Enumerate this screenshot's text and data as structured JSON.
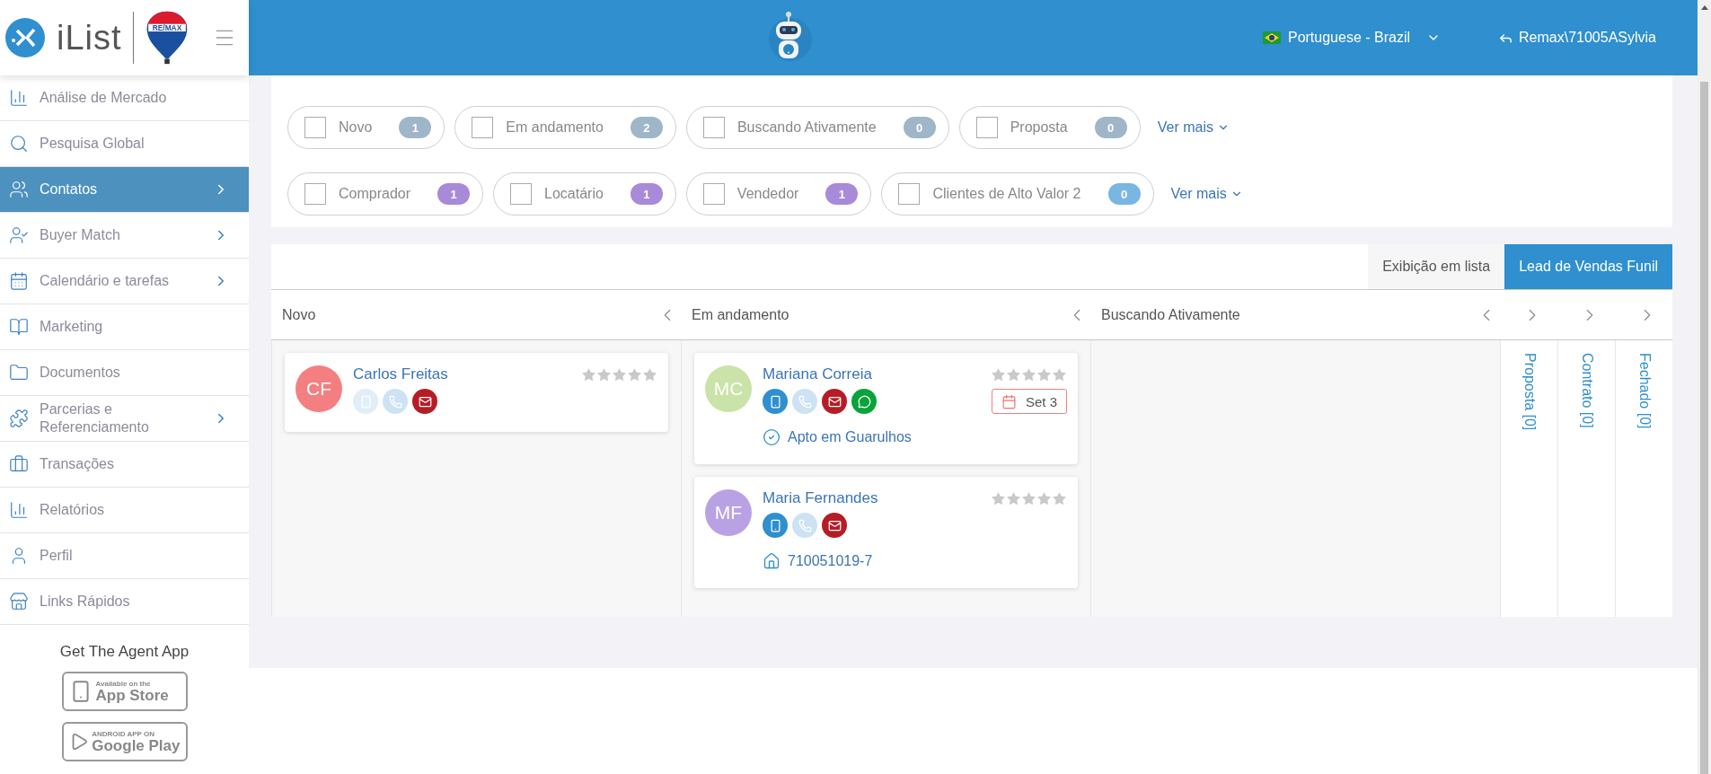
{
  "sidebar": {
    "logo_text": "iList",
    "partner_logo_text": "RE/MAX",
    "items": [
      {
        "label": "Análise de Mercado",
        "has_submenu": false,
        "selected": false
      },
      {
        "label": "Pesquisa Global",
        "has_submenu": false,
        "selected": false
      },
      {
        "label": "Contatos",
        "has_submenu": true,
        "selected": true
      },
      {
        "label": "Buyer Match",
        "has_submenu": true,
        "selected": false
      },
      {
        "label": "Calendário e tarefas",
        "has_submenu": true,
        "selected": false
      },
      {
        "label": "Marketing",
        "has_submenu": false,
        "selected": false
      },
      {
        "label": "Documentos",
        "has_submenu": false,
        "selected": false
      },
      {
        "label": "Parcerias e Referenciamento",
        "has_submenu": true,
        "selected": false
      },
      {
        "label": "Transações",
        "has_submenu": false,
        "selected": false
      },
      {
        "label": "Relatórios",
        "has_submenu": false,
        "selected": false
      },
      {
        "label": "Perfil",
        "has_submenu": false,
        "selected": false
      },
      {
        "label": "Links Rápidos",
        "has_submenu": false,
        "selected": false
      }
    ],
    "app_promo": {
      "title": "Get The Agent App",
      "badges": [
        {
          "kind": "apple",
          "caption": "Available on the",
          "store": "App Store"
        },
        {
          "kind": "android",
          "caption": "ANDROID APP ON",
          "store": "Google Play"
        }
      ]
    }
  },
  "header": {
    "language": "Portuguese - Brazil",
    "user": "Remax\\71005ASylvia"
  },
  "filters": {
    "rows": [
      {
        "chips": [
          {
            "label": "Novo",
            "count": "1",
            "checked": false,
            "color": "#9fb6c8"
          },
          {
            "label": "Em andamento",
            "count": "2",
            "checked": false,
            "color": "#9fb6c8"
          },
          {
            "label": "Buscando Ativamente",
            "count": "0",
            "checked": false,
            "color": "#9fb6c8"
          },
          {
            "label": "Proposta",
            "count": "0",
            "checked": false,
            "color": "#9fb6c8"
          }
        ],
        "more": "Ver mais"
      },
      {
        "chips": [
          {
            "label": "Comprador",
            "count": "1",
            "checked": false,
            "color": "#a88ad8"
          },
          {
            "label": "Locatário",
            "count": "1",
            "checked": false,
            "color": "#a88ad8"
          },
          {
            "label": "Vendedor",
            "count": "1",
            "checked": false,
            "color": "#a88ad8"
          },
          {
            "label": "Clientes de Alto Valor 2",
            "count": "0",
            "checked": false,
            "color": "#79b6e2"
          }
        ],
        "more": "Ver mais"
      }
    ]
  },
  "pipeline": {
    "views": [
      {
        "label": "Exibição em lista",
        "selected": false
      },
      {
        "label": "Lead de Vendas Funil",
        "selected": true
      }
    ],
    "columns": [
      {
        "title": "Novo",
        "expanded": true,
        "cards": [
          {
            "initials": "CF",
            "name": "Carlos Freitas",
            "color": "#f47f80",
            "stars": 0,
            "contacts": [
              {
                "kind": "mobile",
                "disabled": true
              },
              {
                "kind": "phone",
                "disabled": true
              },
              {
                "kind": "email",
                "disabled": false
              }
            ]
          }
        ]
      },
      {
        "title": "Em andamento",
        "expanded": true,
        "cards": [
          {
            "initials": "MC",
            "name": "Mariana Correia",
            "color": "#c9e3a8",
            "stars": 0,
            "contacts": [
              {
                "kind": "mobile",
                "disabled": false
              },
              {
                "kind": "phone",
                "disabled": true
              },
              {
                "kind": "email",
                "disabled": false
              },
              {
                "kind": "whatsapp",
                "disabled": false
              }
            ],
            "due": "Set 3",
            "detail": {
              "kind": "task",
              "text": "Apto em Guarulhos"
            }
          },
          {
            "initials": "MF",
            "name": "Maria Fernandes",
            "color": "#b9a2e4",
            "stars": 0,
            "contacts": [
              {
                "kind": "mobile",
                "disabled": false
              },
              {
                "kind": "phone",
                "disabled": true
              },
              {
                "kind": "email",
                "disabled": false
              }
            ],
            "detail": {
              "kind": "property",
              "text": "710051019-7"
            }
          }
        ]
      },
      {
        "title": "Buscando Ativamente",
        "expanded": true
      },
      {
        "title": "Proposta [0]",
        "expanded": false
      },
      {
        "title": "Contrato [0]",
        "expanded": false
      },
      {
        "title": "Fechado [0]",
        "expanded": false
      }
    ]
  }
}
